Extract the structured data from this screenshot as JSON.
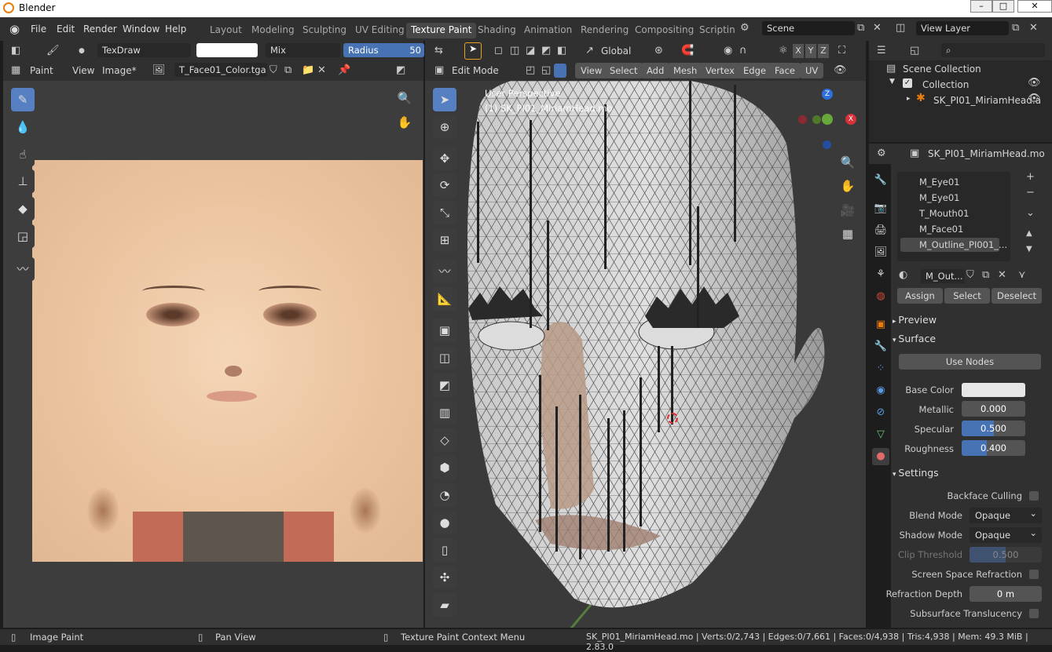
{
  "window": {
    "title": "Blender"
  },
  "menubar": {
    "items": [
      "File",
      "Edit",
      "Render",
      "Window",
      "Help"
    ],
    "workspaces": [
      "Layout",
      "Modeling",
      "Sculpting",
      "UV Editing",
      "Texture Paint",
      "Shading",
      "Animation",
      "Rendering",
      "Compositing",
      "Scriptin"
    ],
    "active_workspace": "Texture Paint",
    "scene": "Scene",
    "view_layer": "View Layer"
  },
  "image_editor": {
    "brush_name": "TexDraw",
    "blend_mode": "Mix",
    "radius_label": "Radius",
    "radius_value": "50",
    "mode": "Paint",
    "menus": [
      "View",
      "Image*"
    ],
    "image_name": "T_Face01_Color.tga"
  },
  "viewport": {
    "mode": "Edit Mode",
    "orientation": "Global",
    "menus": [
      "View",
      "Select",
      "Add",
      "Mesh",
      "Vertex",
      "Edge",
      "Face",
      "UV"
    ],
    "overlay_line1": "User Perspective",
    "overlay_line2": "(1) SK_PI01_MiriamHead.mo",
    "axis_labels": {
      "x": "X",
      "y": "Y",
      "z": "Z"
    }
  },
  "outliner": {
    "scene_collection": "Scene Collection",
    "collection": "Collection",
    "object": "SK_PI01_MiriamHead.a"
  },
  "properties": {
    "object_name": "SK_PI01_MiriamHead.mo",
    "material_slots": [
      "M_Eye01",
      "M_Eye01",
      "T_Mouth01",
      "M_Face01",
      "M_Outline_PI001_..."
    ],
    "active_slot_index": 4,
    "material_name": "M_Out...",
    "assign": "Assign",
    "select": "Select",
    "deselect": "Deselect",
    "preview": "Preview",
    "surface": "Surface",
    "use_nodes": "Use Nodes",
    "base_color_label": "Base Color",
    "base_color": "#e6e6e6",
    "metallic_label": "Metallic",
    "metallic": "0.000",
    "specular_label": "Specular",
    "specular": "0.500",
    "specular_frac": 0.5,
    "roughness_label": "Roughness",
    "roughness": "0.400",
    "roughness_frac": 0.4,
    "settings": "Settings",
    "backface_culling": "Backface Culling",
    "blend_mode_label": "Blend Mode",
    "blend_mode": "Opaque",
    "shadow_mode_label": "Shadow Mode",
    "shadow_mode": "Opaque",
    "clip_threshold_label": "Clip Threshold",
    "clip_threshold": "0.500",
    "clip_frac": 0.5,
    "ssr_label": "Screen Space Refraction",
    "refraction_depth_label": "Refraction Depth",
    "refraction_depth": "0 m",
    "subsurface_label": "Subsurface Translucency"
  },
  "statusbar": {
    "left": "Image Paint",
    "middle": "Pan View",
    "right": "Texture Paint Context Menu",
    "stats": "SK_PI01_MiriamHead.mo | Verts:0/2,743 | Edges:0/7,661 | Faces:0/4,938 | Tris:4,938 | Mem: 49.3 MiB | 2.83.0"
  },
  "colors": {
    "accent": "#4772b3",
    "selection": "#e87d0d",
    "header": "#303030",
    "panel": "#3d3d3d"
  }
}
